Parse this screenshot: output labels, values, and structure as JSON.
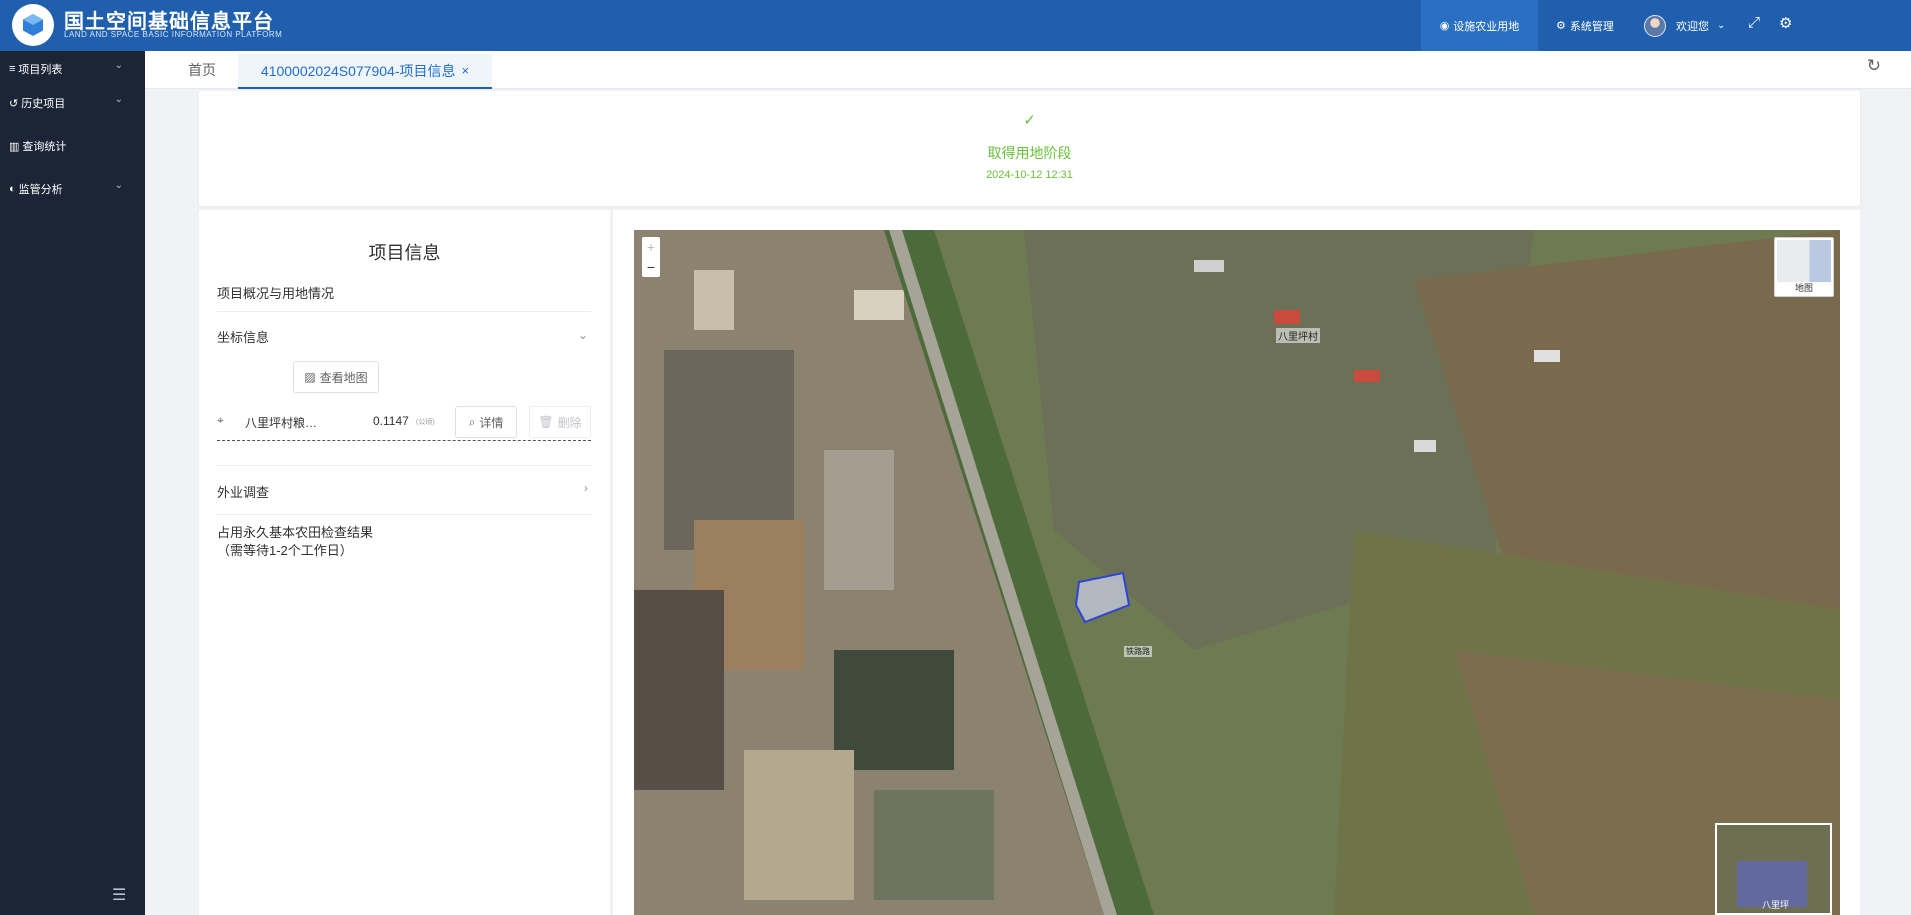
{
  "header": {
    "brand_cn": "国土空间基础信息平台",
    "brand_en": "LAND AND SPACE BASIC INFORMATION PLATFORM",
    "nav_active": "设施农业用地",
    "nav_system": "系统管理",
    "welcome": "欢迎您",
    "accent": "#1f5fae"
  },
  "sidebar": {
    "items": [
      {
        "icon": "list-icon",
        "label": "项目列表"
      },
      {
        "icon": "history-icon",
        "label": "历史项目"
      },
      {
        "icon": "chart-icon",
        "label": "查询统计"
      },
      {
        "icon": "monitor-icon",
        "label": "监管分析"
      }
    ]
  },
  "tabs": {
    "home": "首页",
    "active": "4100002024S077904-项目信息"
  },
  "status": {
    "stage": "取得用地阶段",
    "time": "2024-10-12 12:31",
    "color": "#67c23a"
  },
  "info": {
    "title": "项目信息",
    "overview": "项目概况与用地情况",
    "coords": "坐标信息",
    "view_map": "查看地图",
    "parcel_name": "八里坪村粮…",
    "parcel_area": "0.1147",
    "parcel_unit": "(公顷)",
    "detail": "详情",
    "delete": "删除",
    "field_survey": "外业调查",
    "farmland_line1": "占用永久基本农田检查结果",
    "farmland_line2": "（需等待1-2个工作日）"
  },
  "map": {
    "zoom_in": "+",
    "zoom_out": "−",
    "basemap": "地图",
    "village_label": "八里坪村",
    "road_label": "铁路路",
    "overview_label": "八里坪"
  }
}
